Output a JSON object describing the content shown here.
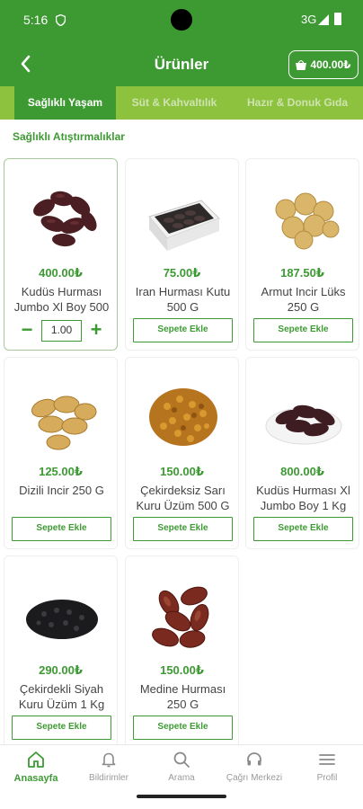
{
  "status_bar": {
    "time": "5:16",
    "network": "3G"
  },
  "header": {
    "title": "Ürünler",
    "cart_total": "400.00₺"
  },
  "tabs": [
    {
      "label": "Sağlıklı Yaşam",
      "active": true
    },
    {
      "label": "Süt & Kahvaltılık",
      "active": false
    },
    {
      "label": "Hazır & Donuk Gıda",
      "active": false
    }
  ],
  "section_title": "Sağlıklı Atıştırmalıklar",
  "add_label": "Sepete Ekle",
  "products": [
    {
      "price": "400.00₺",
      "name": "Kudüs Hurması Jumbo Xl Boy 500",
      "quantity": "1.00",
      "in_cart": true,
      "image": "dates-icon"
    },
    {
      "price": "75.00₺",
      "name": "Iran Hurması Kutu 500 G",
      "in_cart": false,
      "image": "boxed-dates-icon"
    },
    {
      "price": "187.50₺",
      "name": "Armut Incir Lüks 250 G",
      "in_cart": false,
      "image": "dried-figs-icon"
    },
    {
      "price": "125.00₺",
      "name": "Dizili Incir 250 G",
      "in_cart": false,
      "image": "string-figs-icon"
    },
    {
      "price": "150.00₺",
      "name": "Çekirdeksiz Sarı Kuru Üzüm 500 G",
      "in_cart": false,
      "image": "golden-raisins-icon"
    },
    {
      "price": "800.00₺",
      "name": "Kudüs Hurması Xl Jumbo Boy 1 Kg",
      "in_cart": false,
      "image": "dates-plate-icon"
    },
    {
      "price": "290.00₺",
      "name": "Çekirdekli Siyah Kuru Üzüm 1 Kg",
      "in_cart": false,
      "image": "black-raisins-icon"
    },
    {
      "price": "150.00₺",
      "name": "Medine Hurması 250 G",
      "in_cart": false,
      "image": "medjool-dates-icon"
    }
  ],
  "bottom_nav": [
    {
      "label": "Anasayfa",
      "icon": "home-icon",
      "active": true
    },
    {
      "label": "Bildirimler",
      "icon": "bell-icon",
      "active": false
    },
    {
      "label": "Arama",
      "icon": "search-icon",
      "active": false
    },
    {
      "label": "Çağrı Merkezi",
      "icon": "headset-icon",
      "active": false
    },
    {
      "label": "Profil",
      "icon": "menu-icon",
      "active": false
    }
  ],
  "colors": {
    "primary": "#3d9a33",
    "tab_bar": "#8dc23f",
    "inactive_tab_text": "#cfe3b0"
  }
}
